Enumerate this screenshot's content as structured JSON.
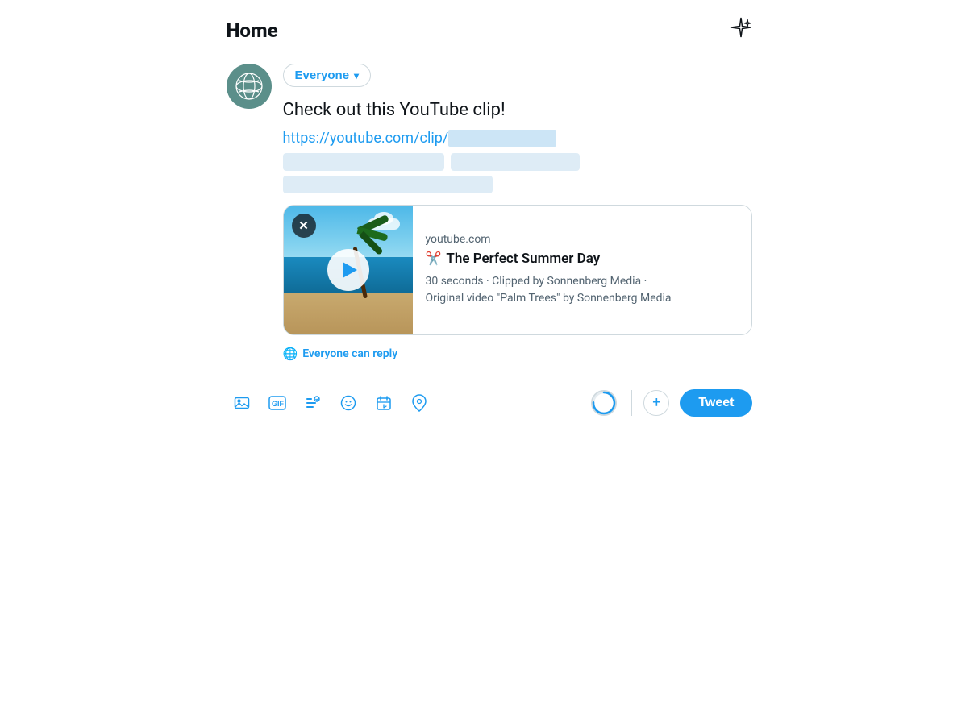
{
  "header": {
    "title": "Home",
    "sparkle_label": "✦"
  },
  "avatar": {
    "alt": "User avatar with globe/leaf pattern"
  },
  "composer": {
    "audience_label": "Everyone",
    "audience_chevron": "▾",
    "tweet_text": "Check out this YouTube clip!",
    "tweet_link": "https://youtube.com/clip/",
    "blurred_suffix": "[redacted]"
  },
  "link_preview": {
    "close_label": "✕",
    "source": "youtube.com",
    "scissors": "✂",
    "title": "The Perfect Summer Day",
    "duration": "30 seconds",
    "meta_line1": "30 seconds · Clipped by Sonnenberg Media ·",
    "meta_line2": "Original video \"Palm Trees\" by Sonnenberg Media",
    "play_label": "Play"
  },
  "reply_permission": {
    "globe": "🌐",
    "label": "Everyone can reply"
  },
  "toolbar": {
    "image_label": "🖼",
    "gif_label": "GIF",
    "thread_label": "≡",
    "emoji_label": "☺",
    "schedule_label": "📅",
    "location_label": "📍",
    "add_label": "+",
    "tweet_label": "Tweet"
  }
}
